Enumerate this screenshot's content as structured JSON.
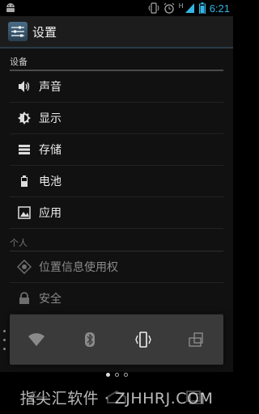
{
  "status": {
    "time": "6:21",
    "network": "H"
  },
  "actionbar": {
    "title": "设置"
  },
  "sections": [
    {
      "header": "设备",
      "items": [
        {
          "label": "声音",
          "icon": "speaker-icon"
        },
        {
          "label": "显示",
          "icon": "brightness-icon"
        },
        {
          "label": "存储",
          "icon": "storage-icon"
        },
        {
          "label": "电池",
          "icon": "battery-icon"
        },
        {
          "label": "应用",
          "icon": "apps-icon"
        }
      ]
    },
    {
      "header": "个人",
      "items": [
        {
          "label": "位置信息使用权",
          "icon": "location-icon"
        },
        {
          "label": "安全",
          "icon": "lock-icon"
        }
      ]
    }
  ],
  "quick_settings": [
    "wifi-icon",
    "bluetooth-icon",
    "vibrate-icon",
    "rotation-icon"
  ],
  "watermark": "指尖汇软件 · ZJHHRJ.COM",
  "colors": {
    "accent": "#33b5e5",
    "background": "#111111",
    "actionbar": "#1c1c1c",
    "quick_panel": "#3a3a3a"
  }
}
